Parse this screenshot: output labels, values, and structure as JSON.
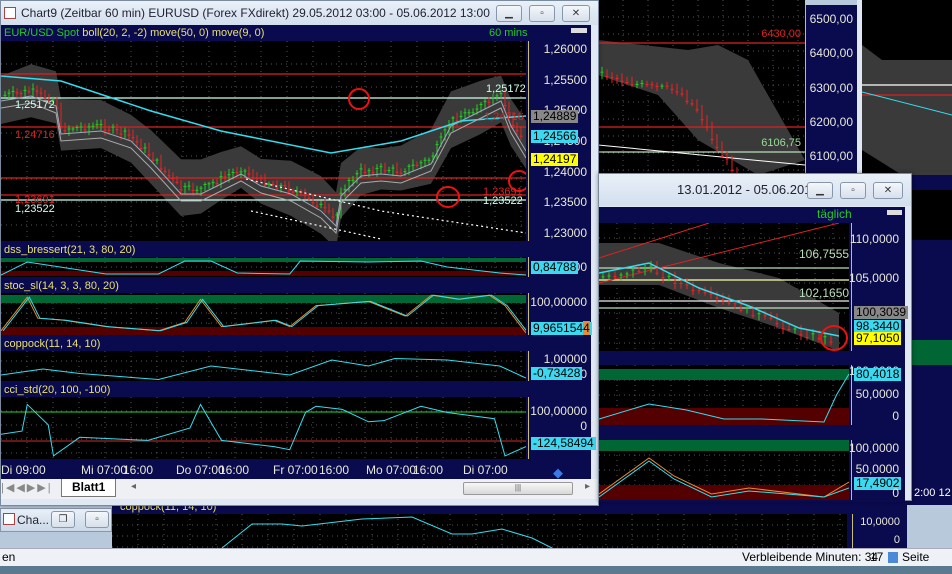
{
  "bg_chart": {
    "axis": [
      "6500,00",
      "6400,00",
      "6300,00",
      "6200,00",
      "6100,00"
    ],
    "level_red": "6430,00",
    "level_green": "6106,75"
  },
  "chart9": {
    "title": "Chart9 (Zeitbar 60 min)  EURUSD (Forex FXdirekt) 29.05.2012 03:00 - 05.06.2012 13:00",
    "header": {
      "instrument": "EUR/USD Spot",
      "indicators": "boll(20, 2, -2) move(50, 0) move(9, 0)",
      "interval": "60 mins"
    },
    "axis": [
      "1,26000",
      "1,25500",
      "1,25000",
      "1,24500",
      "1,24000",
      "1,23500",
      "1,23000"
    ],
    "tags": {
      "gray": "1,24889",
      "cyan": "1,24566",
      "yellow": "1,24197"
    },
    "levels": {
      "g1": "1,25172",
      "g1r": "1,25172",
      "r1": "1,24716",
      "r1r": "1,24716",
      "r2": "1,23691",
      "r2r": "1,23691",
      "g2": "1,23522",
      "g2r": "1,23522"
    },
    "panels": {
      "dss": {
        "label": "dss_bressert(21, 3, 80, 20)",
        "value": "0,84788",
        "axis": "000"
      },
      "stoc": {
        "label": "stoc_sl(14, 3, 3, 80, 20)",
        "top": "100,00000",
        "value": "9,965154",
        "value2": "4",
        "zero": "0"
      },
      "coppock": {
        "label": "coppock(11, 14, 10)",
        "top": "1,00000",
        "value": "-0,73428",
        "axis": "00"
      },
      "cci": {
        "label": "cci_std(20, 100, -100)",
        "top": "100,00000",
        "zero": "0",
        "value": "-124,58494"
      }
    },
    "time_axis": [
      "Di 09:00",
      "Mi 07:00",
      "16:00",
      "Do 07:00",
      "16:00",
      "Fr 07:00",
      "16:00",
      "Mo 07:00",
      "16:00",
      "Di 07:00"
    ],
    "sheet_tab": "Blatt1"
  },
  "chart2": {
    "title": "13.01.2012 - 05.06.2012",
    "interval": "täglich",
    "axis": [
      "110,0000",
      "105,0000"
    ],
    "levels": [
      "106,7555",
      "102,1650"
    ],
    "tags": {
      "gray": "100,3039",
      "cyan": "98,3440",
      "yellow": "97,1050"
    },
    "p1": {
      "top": "100,0000",
      "value": "80,4018",
      "mid": "50,0000",
      "zero": "0"
    },
    "p2": {
      "top": "100,0000",
      "mid": "50,0000",
      "value": "17,4902",
      "zero": "0"
    }
  },
  "bottom": {
    "minimized_title": "Cha...",
    "coppock": "coppock(11, 14, 10)",
    "axis": "10,0000",
    "zero": "0",
    "right_time": "2:00 12"
  },
  "status": {
    "left": "en",
    "remaining": "Verbleibende Minuten: 34",
    "num": "17",
    "page": "Seite"
  }
}
